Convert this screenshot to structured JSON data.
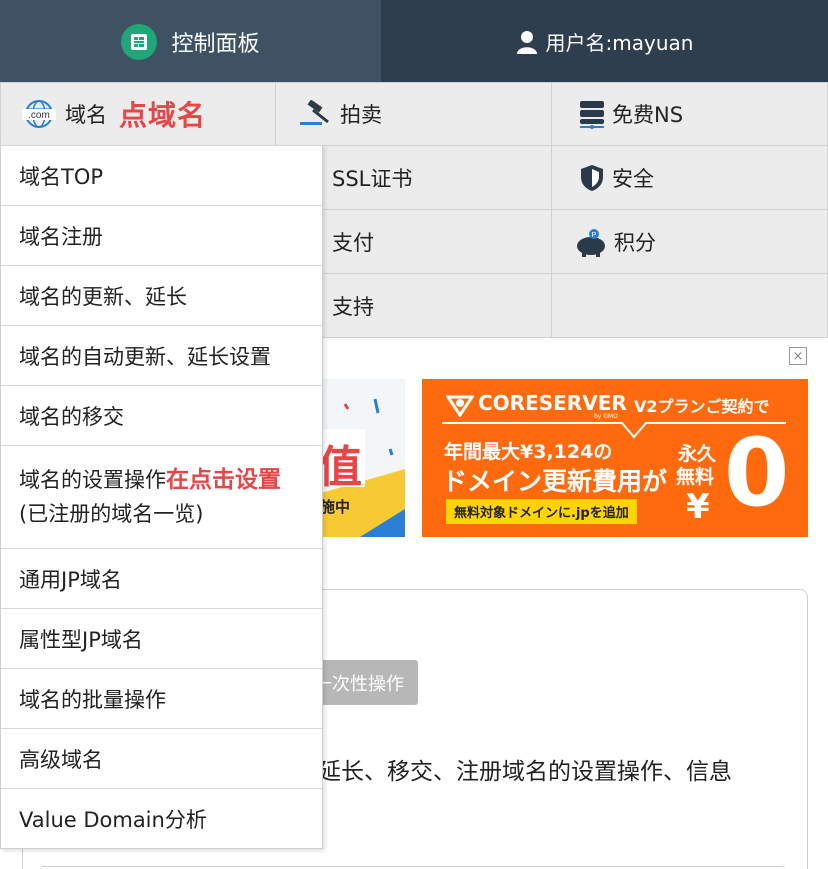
{
  "header": {
    "dashboard_label": "控制面板",
    "username_label": "用户名:mayuan"
  },
  "nav": {
    "domain_label": "域名",
    "domain_annotation": "点域名",
    "auction_label": "拍卖",
    "free_ns_label": "免费NS",
    "ssl_label": "SSL证书",
    "security_label": "安全",
    "payment_label": "支付",
    "points_label": "积分",
    "support_label": "支持"
  },
  "dropdown": {
    "items": [
      "域名TOP",
      "域名注册",
      "域名的更新、延长",
      "域名的自动更新、延长设置",
      "域名的移交",
      "域名的设置操作",
      "(已注册的域名一览)",
      "通用JP域名",
      "属性型JP域名",
      "域名的批量操作",
      "高级域名",
      "Value Domain分析"
    ],
    "settings_annotation": "在点击设置"
  },
  "ads": {
    "close_symbol": "×",
    "left_big_char": "值",
    "left_small_text": "施中",
    "right_brand": "CORESERVER",
    "right_brand_sub": "by GMO",
    "right_plan": "V2プランご契約で",
    "right_line1": "年間最大¥3,124の",
    "right_line2": "ドメイン更新費用が",
    "right_free1": "永久",
    "right_free2": "無料",
    "right_yen": "¥",
    "right_zero": "0",
    "right_bottom": "無料対象ドメインに.jpを追加"
  },
  "content": {
    "tag_text": "一次性操作",
    "description_fragment": "延长、移交、注册域名的设置操作、信息"
  },
  "colors": {
    "header_dark": "#2e3e4e",
    "header_active": "#3e5264",
    "dashboard_green": "#1fa77a",
    "nav_bg": "#ececec",
    "annotation_red": "#e84646",
    "ad_orange": "#ff6a0e"
  }
}
